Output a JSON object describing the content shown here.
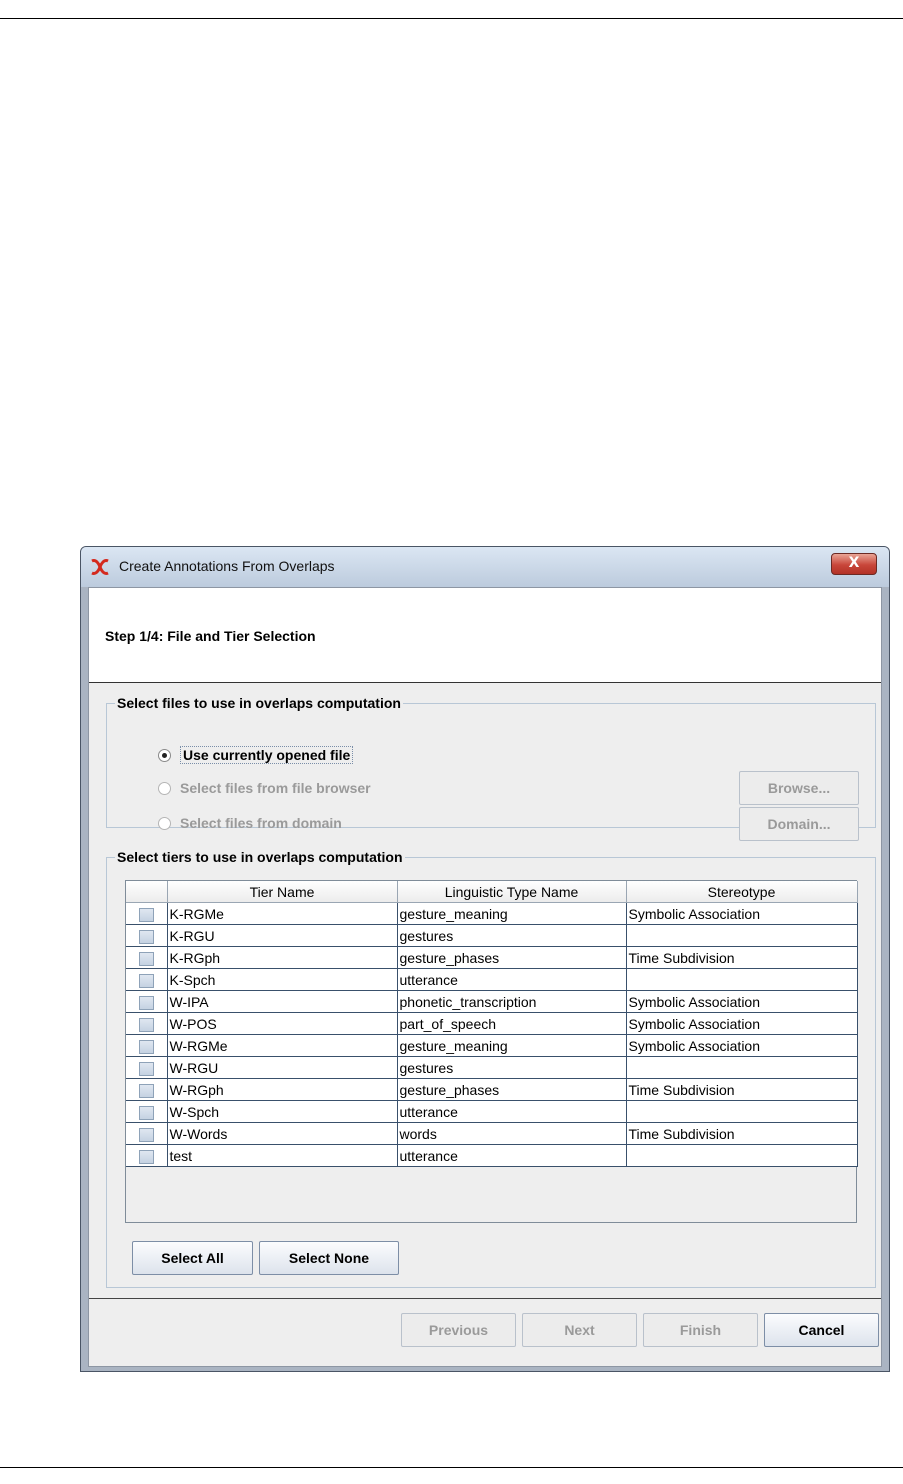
{
  "window": {
    "title": "Create Annotations From Overlaps",
    "close_label": "X"
  },
  "step": {
    "title": "Step 1/4: File and Tier Selection"
  },
  "files_group": {
    "legend": "Select files to use in overlaps computation",
    "options": [
      {
        "label": "Use currently opened file",
        "checked": true,
        "enabled": true
      },
      {
        "label": "Select files from file browser",
        "checked": false,
        "enabled": false
      },
      {
        "label": "Select files from domain",
        "checked": false,
        "enabled": false
      }
    ],
    "browse_label": "Browse...",
    "domain_label": "Domain..."
  },
  "tiers_group": {
    "legend": "Select tiers to use in overlaps computation",
    "columns": [
      "Tier Name",
      "Linguistic Type Name",
      "Stereotype"
    ],
    "rows": [
      {
        "tier": "K-RGMe",
        "type": "gesture_meaning",
        "stereotype": "Symbolic Association"
      },
      {
        "tier": "K-RGU",
        "type": "gestures",
        "stereotype": ""
      },
      {
        "tier": "K-RGph",
        "type": "gesture_phases",
        "stereotype": "Time Subdivision"
      },
      {
        "tier": "K-Spch",
        "type": "utterance",
        "stereotype": ""
      },
      {
        "tier": "W-IPA",
        "type": "phonetic_transcription",
        "stereotype": "Symbolic Association"
      },
      {
        "tier": "W-POS",
        "type": "part_of_speech",
        "stereotype": "Symbolic Association"
      },
      {
        "tier": "W-RGMe",
        "type": "gesture_meaning",
        "stereotype": "Symbolic Association"
      },
      {
        "tier": "W-RGU",
        "type": "gestures",
        "stereotype": ""
      },
      {
        "tier": "W-RGph",
        "type": "gesture_phases",
        "stereotype": "Time Subdivision"
      },
      {
        "tier": "W-Spch",
        "type": "utterance",
        "stereotype": ""
      },
      {
        "tier": "W-Words",
        "type": "words",
        "stereotype": "Time Subdivision"
      },
      {
        "tier": "test",
        "type": "utterance",
        "stereotype": ""
      }
    ],
    "select_all_label": "Select All",
    "select_none_label": "Select None"
  },
  "footer": {
    "previous_label": "Previous",
    "next_label": "Next",
    "finish_label": "Finish",
    "cancel_label": "Cancel"
  },
  "colors": {
    "titlebar": "#c9d7e8",
    "close_button": "#c8463a",
    "panel": "#eeeeee"
  }
}
